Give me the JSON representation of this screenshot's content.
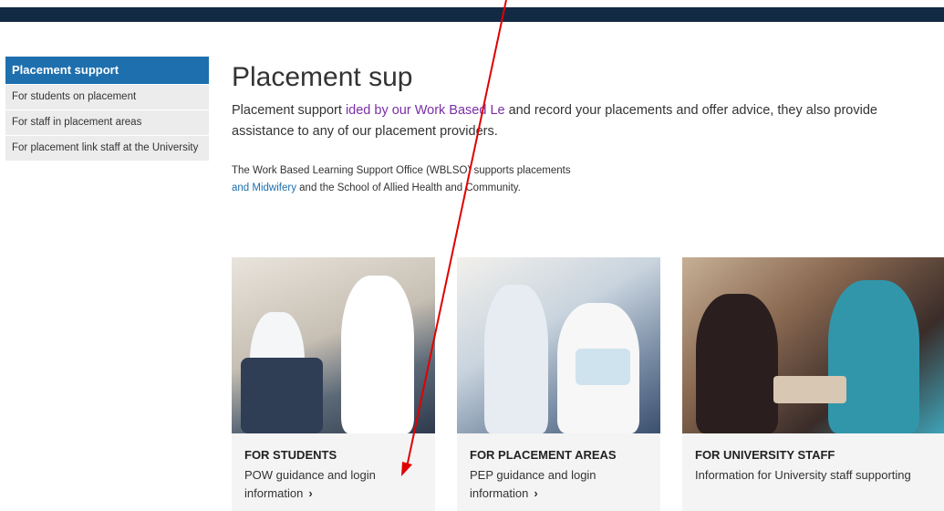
{
  "sidebar": {
    "header": "Placement support",
    "items": [
      {
        "label": "For students on placement"
      },
      {
        "label": "For staff in placement areas"
      },
      {
        "label": "For placement link staff at the University"
      }
    ]
  },
  "main": {
    "title": "Placement sup",
    "lead_before_link": "Placement support ",
    "lead_link": "ided by our Work Based Le",
    "lead_after": " and record your placements and offer advice, they also provide assistance to any of our placement providers.",
    "intro_before": "The Work Based Learning Support Office (WBLSO) supports placements ",
    "intro_link": "and Midwifery",
    "intro_after": " and the School of Allied Health and Community."
  },
  "cards": [
    {
      "title": "FOR STUDENTS",
      "desc": "POW guidance and login information",
      "chevron": "›"
    },
    {
      "title": "FOR PLACEMENT AREAS",
      "desc": "PEP guidance and login information",
      "chevron": "›"
    },
    {
      "title": "FOR UNIVERSITY STAFF",
      "desc": "Information for University staff supporting",
      "chevron": ""
    }
  ],
  "colors": {
    "topbar": "#132a44",
    "sidebar_header": "#1e6fae",
    "annotation_arrow": "#e00000"
  }
}
